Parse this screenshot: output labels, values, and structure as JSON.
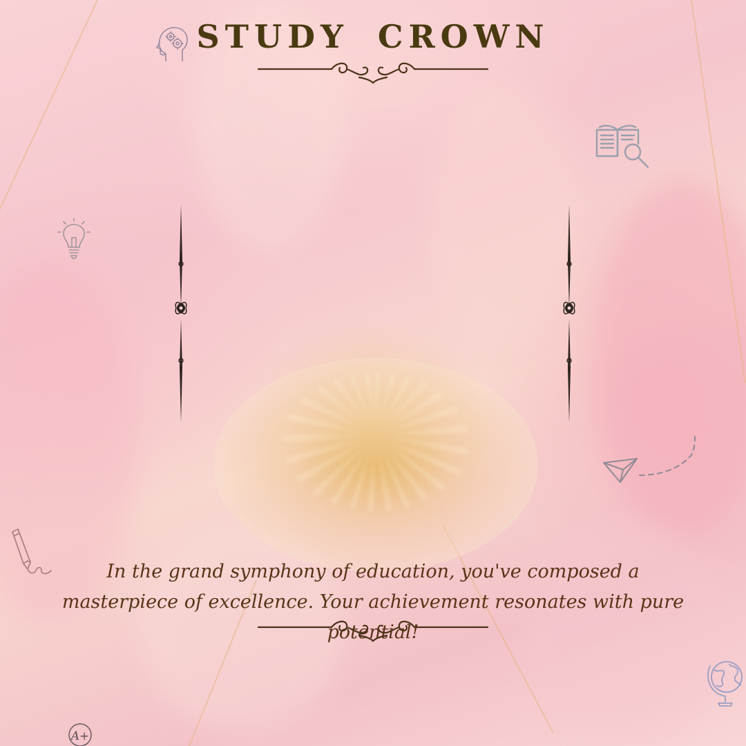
{
  "title": "STUDY CROWN",
  "message": "In the grand symphony of education, you've composed a masterpiece of excellence. Your achievement resonates with pure potential!",
  "badge_text": "A+",
  "icons": [
    "brain-gears-icon",
    "book-magnifier-icon",
    "lightbulb-icon",
    "paper-plane-icon",
    "pencil-icon",
    "grade-badge-icon",
    "globe-icon"
  ],
  "colors": {
    "title": "#4a3a12",
    "message": "#5a3318",
    "ornament": "#4a3218",
    "icon_line": "#9a8aa0",
    "background": "#f6cfd2"
  }
}
